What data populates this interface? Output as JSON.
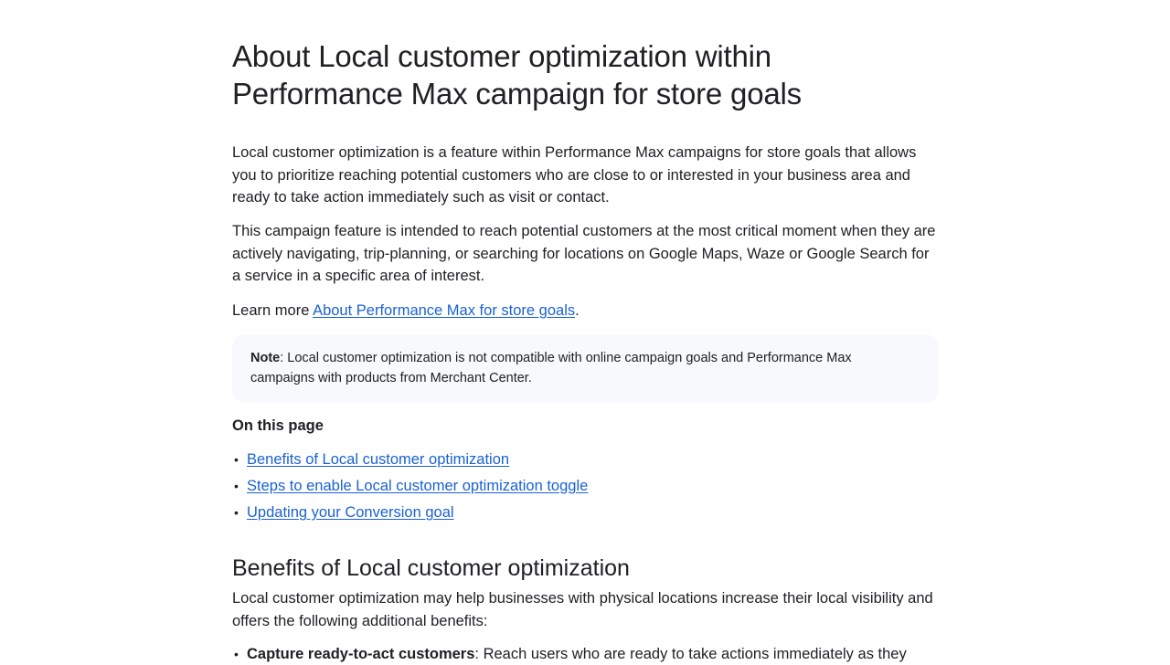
{
  "article": {
    "title_line1": "About Local customer optimization within",
    "title_line2": "Performance Max campaign for store goals",
    "intro_paragraph": "Local customer optimization is a feature within Performance Max campaigns for store goals that allows you to prioritize reaching potential customers who are close to or interested in your business area and ready to take action immediately such as visit or contact.",
    "second_paragraph": "This campaign feature is intended to reach potential customers at the most critical moment when they are actively navigating, trip-planning, or searching for locations on Google Maps, Waze or Google Search for a service in a specific area of interest.",
    "learn_more_prefix": "Learn more ",
    "learn_more_link": "About Performance Max for store goals",
    "learn_more_suffix": "."
  },
  "note": {
    "label": "Note",
    "text": ": Local customer optimization is not compatible with online campaign goals and Performance Max campaigns with products from Merchant Center."
  },
  "toc": {
    "heading": "On this page",
    "items": [
      "Benefits of Local customer optimization",
      "Steps to enable Local customer optimization toggle",
      "Updating your Conversion goal"
    ]
  },
  "benefits_section": {
    "heading": "Benefits of Local customer optimization",
    "paragraph": "Local customer optimization may help businesses with physical locations increase their local visibility and offers the following additional benefits:",
    "items": [
      {
        "bold": "Capture ready-to-act customers",
        "text": ": Reach users who are ready to take actions immediately as they"
      }
    ]
  },
  "colors": {
    "link": "#1a62d2",
    "text": "#202124",
    "note_background": "#f7f9fc"
  }
}
